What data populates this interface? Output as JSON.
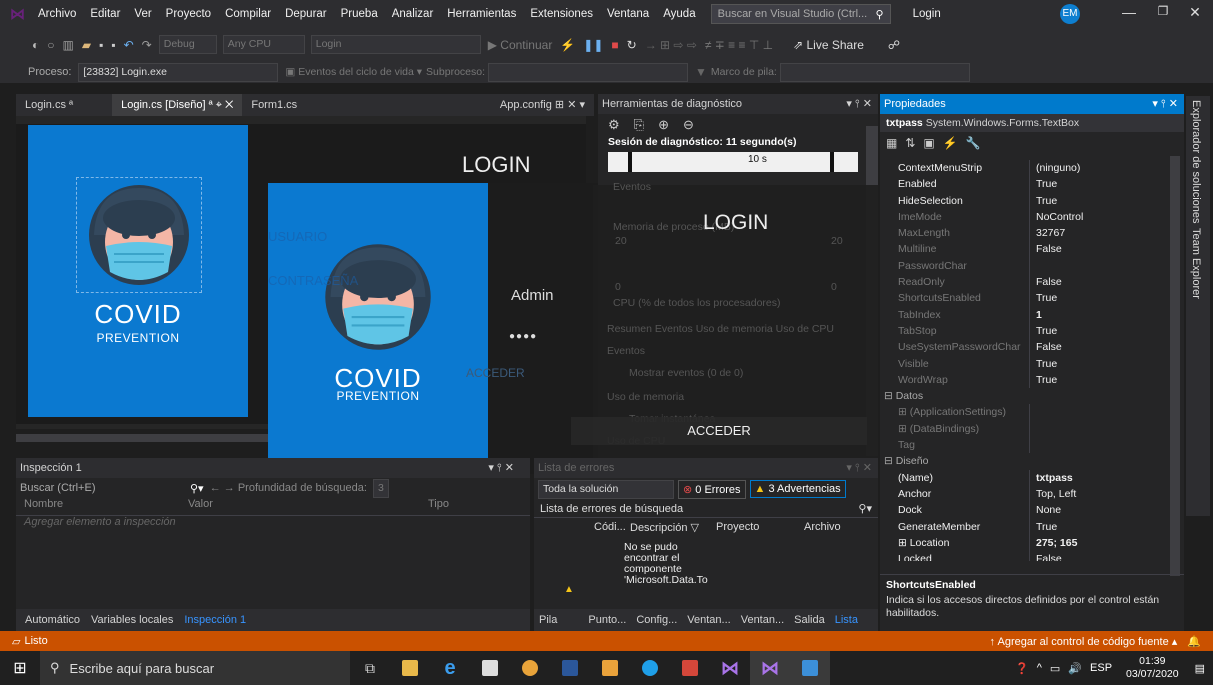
{
  "menu": {
    "items": [
      "Archivo",
      "Editar",
      "Ver",
      "Proyecto",
      "Compilar",
      "Depurar",
      "Prueba",
      "Analizar",
      "Herramientas",
      "Extensiones",
      "Ventana",
      "Ayuda"
    ],
    "search_placeholder": "Buscar en Visual Studio (Ctrl...",
    "window_title": "Login",
    "avatar": "EM"
  },
  "toolbar": {
    "config": "Debug",
    "platform": "Any CPU",
    "startup": "Login",
    "continue": "Continuar",
    "live_share": "Live Share"
  },
  "toolbar2": {
    "process_label": "Proceso:",
    "process_value": "[23832] Login.exe",
    "events_label": "Eventos del ciclo de vida",
    "subprocess_label": "Subproceso:",
    "stack_label": "Marco de pila:"
  },
  "editor_tabs": {
    "tab1": "Login.cs",
    "tab2": "Login.cs [Diseño]",
    "tab3": "Form1.cs",
    "tab4": "App.config"
  },
  "designer": {
    "covid": "COVID",
    "prevention": "PREVENTION",
    "login": "LOGIN"
  },
  "runtime": {
    "covid": "COVID",
    "prevention": "PREVENTION",
    "usuario": "USUARIO",
    "contrasena": "CONTRASEÑA",
    "user_value": "Admin",
    "pass_value": "●●●●",
    "acceder_ghost": "ACCEDER",
    "login_title": "LOGIN",
    "acceder": "ACCEDER"
  },
  "diag": {
    "title": "Herramientas de diagnóstico",
    "session": "Sesión de diagnóstico: 11 segundo(s)",
    "tick": "10 s",
    "events": "Eventos",
    "memory": "Memoria de proceso (MB)",
    "cpu": "CPU (% de todos los procesadores)",
    "mem_max": "20",
    "mem_min": "0",
    "subtabs": "Resumen  Eventos  Uso de memoria  Uso de CPU",
    "ev_header": "Eventos",
    "show_events": "Mostrar eventos (0 de 0)",
    "mem_usage": "Uso de memoria",
    "snapshot": "Tomar instantánea",
    "cpu_usage": "Uso de CPU"
  },
  "props": {
    "title": "Propiedades",
    "object": "txtpass",
    "object_type": "System.Windows.Forms.TextBox",
    "rows": [
      [
        "ContextMenuStrip",
        "(ninguno)",
        ""
      ],
      [
        "Enabled",
        "True",
        ""
      ],
      [
        "HideSelection",
        "True",
        ""
      ],
      [
        "ImeMode",
        "NoControl",
        ""
      ],
      [
        "MaxLength",
        "32767",
        ""
      ],
      [
        "Multiline",
        "False",
        ""
      ],
      [
        "PasswordChar",
        "",
        ""
      ],
      [
        "ReadOnly",
        "False",
        ""
      ],
      [
        "ShortcutsEnabled",
        "True",
        ""
      ],
      [
        "TabIndex",
        "1",
        "b"
      ],
      [
        "TabStop",
        "True",
        ""
      ],
      [
        "UseSystemPasswordChar",
        "False",
        ""
      ],
      [
        "Visible",
        "True",
        ""
      ],
      [
        "WordWrap",
        "True",
        ""
      ],
      [
        "Datos",
        "",
        "c"
      ],
      [
        "(ApplicationSettings)",
        "",
        ""
      ],
      [
        "(DataBindings)",
        "",
        ""
      ],
      [
        "Tag",
        "",
        ""
      ],
      [
        "Diseño",
        "",
        "c"
      ],
      [
        "(Name)",
        "txtpass",
        "b"
      ],
      [
        "Anchor",
        "Top, Left",
        ""
      ],
      [
        "Dock",
        "None",
        ""
      ],
      [
        "GenerateMember",
        "True",
        ""
      ],
      [
        "Location",
        "275; 165",
        "b"
      ],
      [
        "Locked",
        "False",
        ""
      ]
    ],
    "desc_title": "ShortcutsEnabled",
    "desc_text": "Indica si los accesos directos definidos por el control están habilitados."
  },
  "side_tabs": {
    "explorer": "Explorador de soluciones",
    "team": "Team Explorer"
  },
  "watch": {
    "title": "Inspección 1",
    "search": "Buscar (Ctrl+E)",
    "depth_label": "Profundidad de búsqueda:",
    "depth": "3",
    "col_name": "Nombre",
    "col_value": "Valor",
    "col_type": "Tipo",
    "add": "Agregar elemento a inspección",
    "tabs": [
      "Automático",
      "Variables locales",
      "Inspección 1"
    ]
  },
  "errors": {
    "title": "Lista de errores",
    "scope": "Toda la solución",
    "errors": "0 Errores",
    "warnings": "3 Advertencias",
    "search": "Lista de errores de búsqueda",
    "col_code": "Códi...",
    "col_desc": "Descripción",
    "col_proj": "Proyecto",
    "col_file": "Archivo",
    "msg": "No se pudo encontrar el componente 'Microsoft.Data.To",
    "tabs": [
      "Pila de...",
      "Punto...",
      "Config...",
      "Ventan...",
      "Ventan...",
      "Salida",
      "Lista d..."
    ]
  },
  "status": {
    "ready": "Listo",
    "source_control": "Agregar al control de código fuente"
  },
  "taskbar": {
    "search": "Escribe aquí para buscar",
    "lang": "ESP",
    "time": "01:39",
    "date": "03/07/2020"
  }
}
